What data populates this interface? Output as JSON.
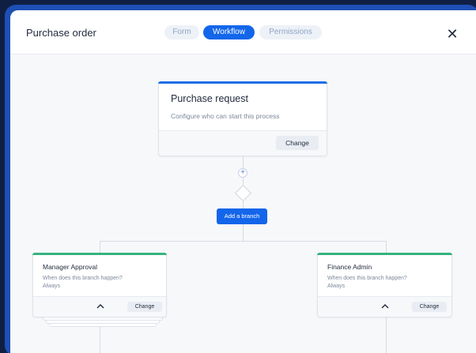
{
  "header": {
    "title": "Purchase order",
    "tabs": [
      {
        "label": "Form",
        "active": false
      },
      {
        "label": "Workflow",
        "active": true
      },
      {
        "label": "Permissions",
        "active": false
      }
    ],
    "close_icon": "close-icon"
  },
  "trigger": {
    "title": "Purchase request",
    "subtitle": "Configure who can start this process",
    "change_label": "Change",
    "accent": "#1c6fe8"
  },
  "connector": {
    "plus_label": "+",
    "add_branch_label": "Add a branch"
  },
  "branches": [
    {
      "title": "Manager Approval",
      "question": "When does this branch happen?",
      "answer": "Always",
      "change_label": "Change",
      "accent": "#36b37e"
    },
    {
      "title": "Finance Admin",
      "question": "When does this branch happen?",
      "answer": "Always",
      "change_label": "Change",
      "accent": "#36b37e"
    }
  ]
}
